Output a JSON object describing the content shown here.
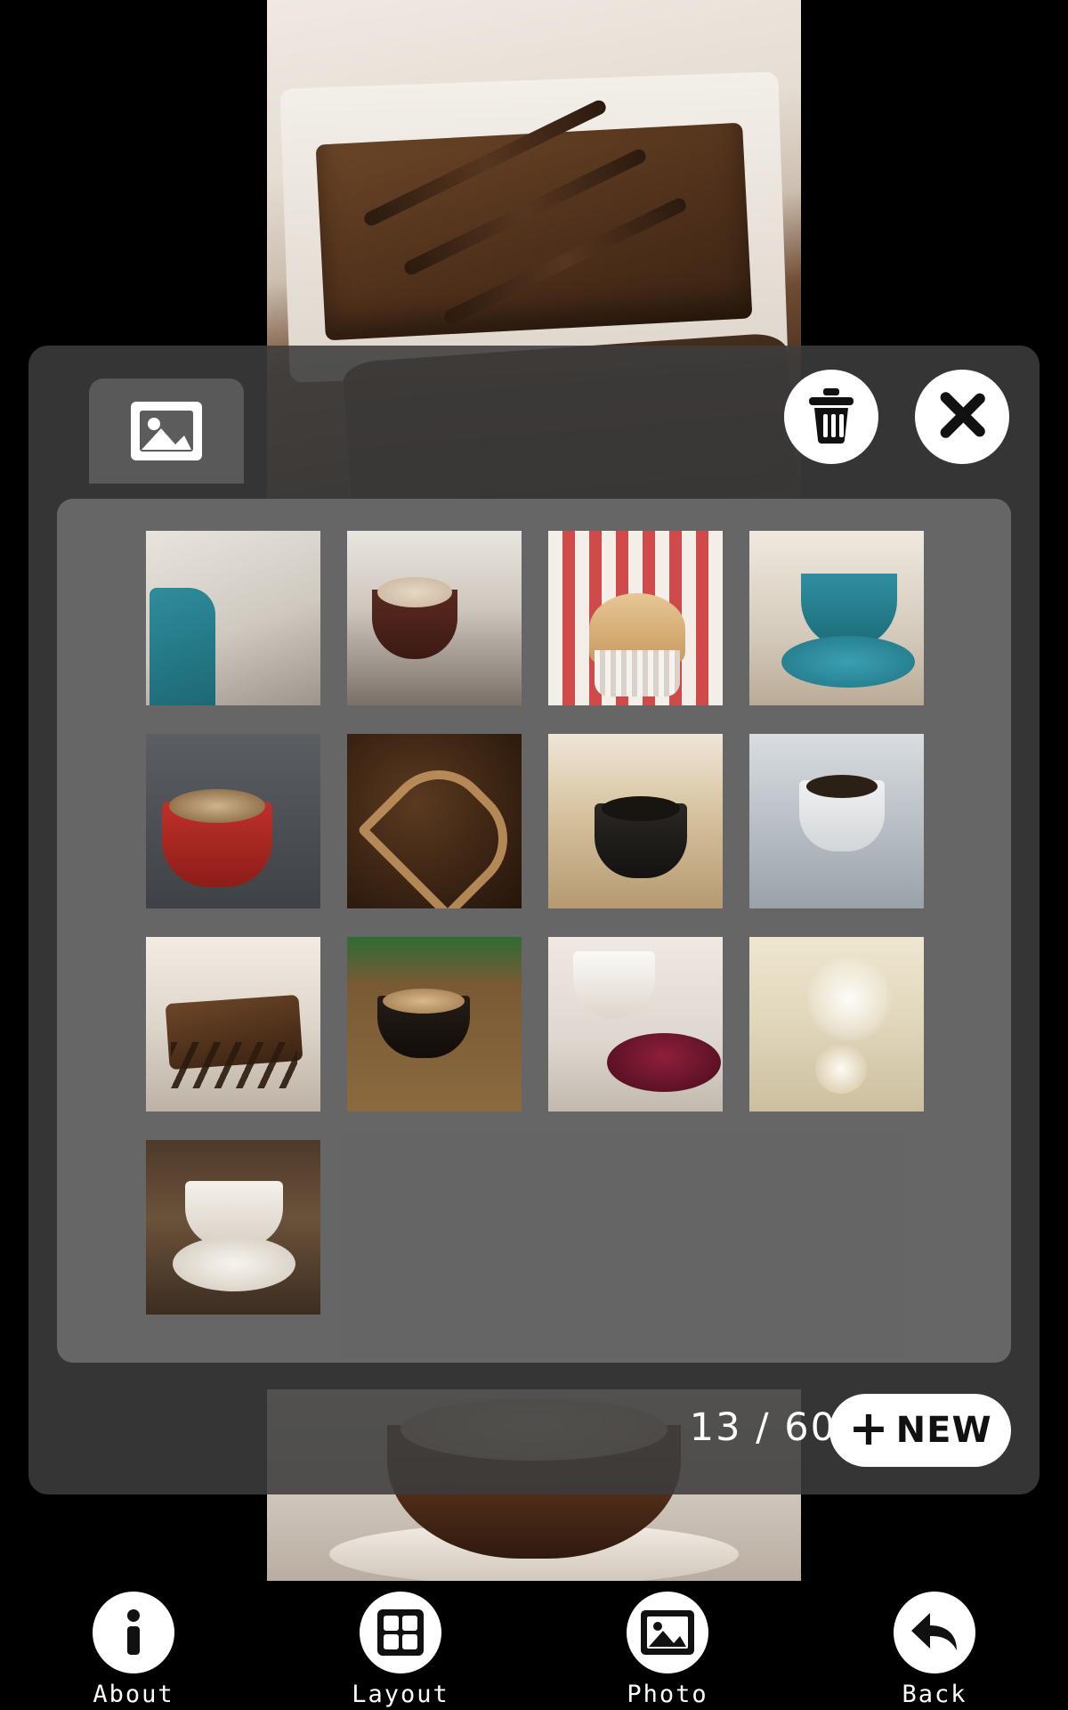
{
  "app": {
    "counter_text": "13 / 60"
  },
  "toolbar": {
    "tab_photo_icon": "image-icon",
    "delete_icon": "trash-icon",
    "close_icon": "close-x-icon",
    "new_label": "NEW",
    "new_plus": "+"
  },
  "gallery": {
    "thumbnails": [
      {
        "name": "latte-art-with-book",
        "alt": "Latte art cup held over an open book"
      },
      {
        "name": "two-latte-cups",
        "alt": "Two cappuccino cups on a table"
      },
      {
        "name": "berry-muffin",
        "alt": "Muffin with berries on checkered cloth"
      },
      {
        "name": "teal-cup-biscotti",
        "alt": "Teal cup of coffee with biscotti"
      },
      {
        "name": "red-cup-coffee",
        "alt": "Red cup of coffee with cookies"
      },
      {
        "name": "coffee-beans-heart",
        "alt": "Coffee beans arranged in a heart"
      },
      {
        "name": "black-coffee-cup",
        "alt": "Black coffee in a dark cup on board"
      },
      {
        "name": "white-cup-knit",
        "alt": "White cup of coffee on knitted blanket"
      },
      {
        "name": "chocolate-brownie",
        "alt": "Chocolate drizzled brownie on plate"
      },
      {
        "name": "latte-on-wood",
        "alt": "Latte cup on a wooden table"
      },
      {
        "name": "berry-tart",
        "alt": "Berry tart with a white cup"
      },
      {
        "name": "dandelion-seeds",
        "alt": "Dandelion seeds close up"
      },
      {
        "name": "cappuccino-on-wood",
        "alt": "Cappuccino with spoon on rustic wood"
      }
    ]
  },
  "bottom_bar": {
    "items": [
      {
        "label": "About",
        "icon": "info-icon"
      },
      {
        "label": "Layout",
        "icon": "grid-icon"
      },
      {
        "label": "Photo",
        "icon": "image-icon"
      },
      {
        "label": "Back",
        "icon": "back-arrow-icon"
      }
    ]
  }
}
